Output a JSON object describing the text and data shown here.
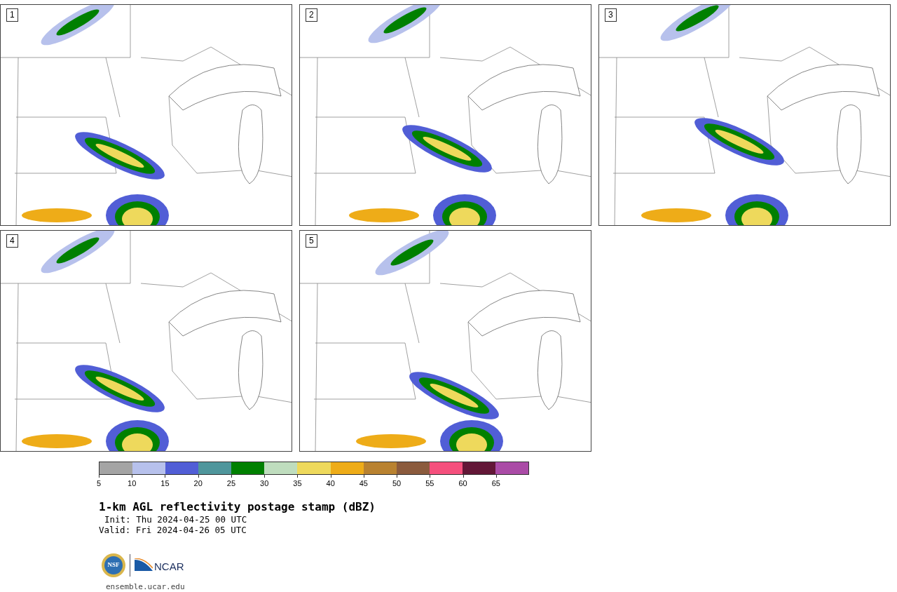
{
  "panels": [
    {
      "label": "1"
    },
    {
      "label": "2"
    },
    {
      "label": "3"
    },
    {
      "label": "4"
    },
    {
      "label": "5"
    }
  ],
  "colorbar": {
    "segments": [
      {
        "color": "#a4a4a4"
      },
      {
        "color": "#b7c1ec"
      },
      {
        "color": "#515ed6"
      },
      {
        "color": "#4f969c"
      },
      {
        "color": "#008000"
      },
      {
        "color": "#bfddbe"
      },
      {
        "color": "#eed95c"
      },
      {
        "color": "#eeac18"
      },
      {
        "color": "#b98230"
      },
      {
        "color": "#8b5b3d"
      },
      {
        "color": "#f5507d"
      },
      {
        "color": "#631737"
      },
      {
        "color": "#aa4ba6"
      }
    ],
    "ticks": [
      "5",
      "10",
      "15",
      "20",
      "25",
      "30",
      "35",
      "40",
      "45",
      "50",
      "55",
      "60",
      "65"
    ]
  },
  "title": "1-km AGL reflectivity postage stamp (dBZ)",
  "init": "Init: Thu 2024-04-25 00 UTC",
  "valid": "Valid: Fri 2024-04-26 05 UTC",
  "logos": {
    "nsf": "NSF",
    "ncar": "NCAR"
  },
  "footer": "ensemble.ucar.edu"
}
